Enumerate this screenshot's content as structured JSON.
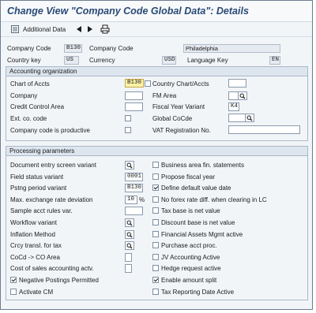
{
  "title": "Change View \"Company Code Global Data\": Details",
  "toolbar": {
    "additional_data_label": "Additional Data"
  },
  "header": {
    "company_code_label": "Company Code",
    "company_code_value": "B130",
    "company_name_label": "Company Code",
    "company_name_value": "Philadelphia",
    "country_key_label": "Country key",
    "country_key_value": "US",
    "currency_label": "Currency",
    "currency_value": "USD",
    "language_key_label": "Language Key",
    "language_key_value": "EN"
  },
  "accounting": {
    "heading": "Accounting organization",
    "chart_of_accts_label": "Chart of Accts",
    "chart_of_accts_value": "B130",
    "country_chart_label": "Country Chart/Accts",
    "country_chart_value": "",
    "company_label": "Company",
    "company_value": "",
    "fm_area_label": "FM Area",
    "fm_area_value": "",
    "credit_control_label": "Credit Control Area",
    "credit_control_value": "",
    "fiscal_year_label": "Fiscal Year Variant",
    "fiscal_year_value": "K4",
    "ext_co_code_label": "Ext. co. code",
    "ext_co_code_checked": false,
    "global_cocde_label": "Global CoCde",
    "global_cocde_value": "",
    "productive_label": "Company code is productive",
    "productive_checked": false,
    "vat_label": "VAT Registration No.",
    "vat_value": ""
  },
  "processing": {
    "heading": "Processing parameters",
    "left": [
      {
        "label": "Document entry screen variant",
        "type": "search",
        "value": ""
      },
      {
        "label": "Field status variant",
        "type": "field",
        "value": "0001"
      },
      {
        "label": "Pstng period variant",
        "type": "field",
        "value": "B130"
      },
      {
        "label": "Max. exchange rate deviation",
        "type": "percent",
        "value": "10",
        "unit": "%"
      },
      {
        "label": "Sample acct rules var.",
        "type": "field",
        "value": ""
      },
      {
        "label": "Workflow variant",
        "type": "search",
        "value": ""
      },
      {
        "label": "Inflation Method",
        "type": "search",
        "value": ""
      },
      {
        "label": "Crcy transl. for tax",
        "type": "search",
        "value": ""
      },
      {
        "label": "CoCd -> CO Area",
        "type": "field-small",
        "value": ""
      },
      {
        "label": "Cost of sales accounting actv.",
        "type": "field-small",
        "value": ""
      }
    ],
    "left_checks": [
      {
        "label": "Negative Postings Permitted",
        "checked": true
      },
      {
        "label": "Activate CM",
        "checked": false
      }
    ],
    "right": [
      {
        "label": "Business area fin. statements",
        "checked": false
      },
      {
        "label": "Propose fiscal year",
        "checked": false
      },
      {
        "label": "Define default value date",
        "checked": true
      },
      {
        "label": "No forex rate diff. when clearing in LC",
        "checked": false
      },
      {
        "label": "Tax base is net value",
        "checked": false
      },
      {
        "label": "Discount base is net value",
        "checked": false
      },
      {
        "label": "Financial Assets Mgmt active",
        "checked": false
      },
      {
        "label": "Purchase acct proc.",
        "checked": false
      },
      {
        "label": "JV Accounting Active",
        "checked": false
      },
      {
        "label": "Hedge request active",
        "checked": false
      },
      {
        "label": "Enable amount split",
        "checked": true
      },
      {
        "label": "Tax Reporting Date Active",
        "checked": false
      }
    ]
  }
}
